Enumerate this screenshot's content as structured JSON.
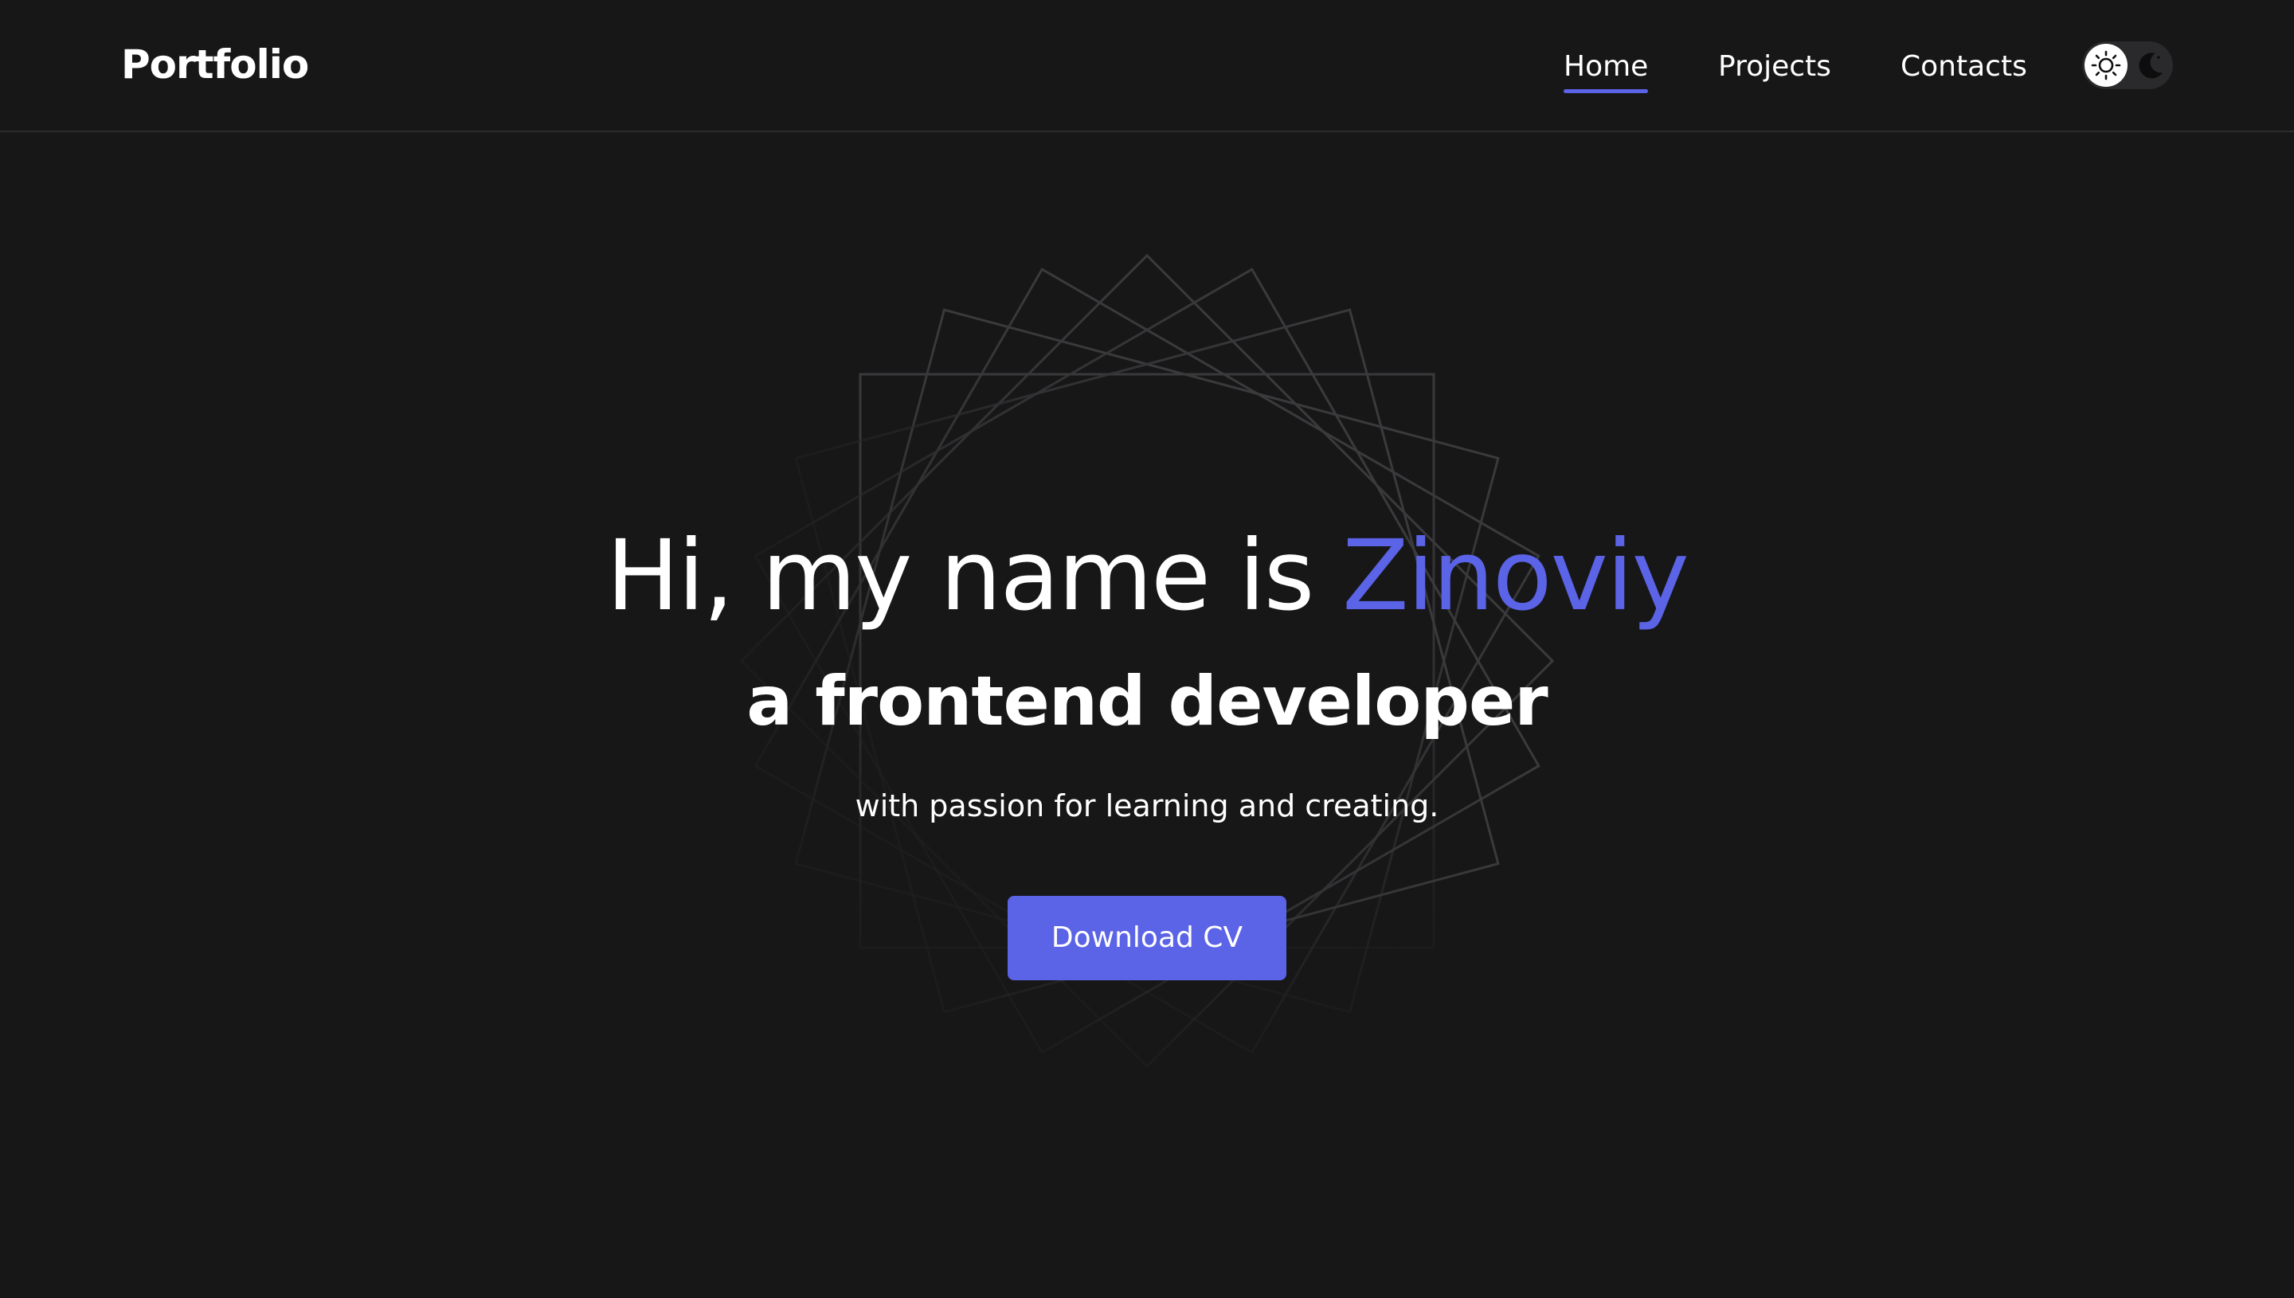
{
  "header": {
    "logo": "Portfolio",
    "nav": [
      {
        "label": "Home",
        "active": true
      },
      {
        "label": "Projects",
        "active": false
      },
      {
        "label": "Contacts",
        "active": false
      }
    ],
    "theme_toggle": {
      "light_icon": "sun-icon",
      "dark_icon": "moon-icon",
      "selected": "light"
    }
  },
  "hero": {
    "title_prefix": "Hi, my name is ",
    "name": "Zinoviy",
    "subtitle": "a frontend developer",
    "tagline": "with passion for learning and creating.",
    "cta_label": "Download CV"
  },
  "colors": {
    "background": "#171718",
    "accent": "#5b63e6",
    "text": "#ffffff",
    "divider": "#2c2c2e"
  }
}
